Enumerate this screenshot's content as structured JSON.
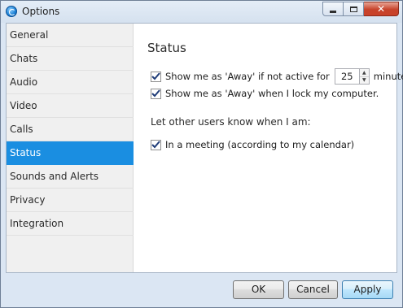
{
  "window": {
    "title": "Options",
    "buttons": {
      "minimize": "minimize",
      "maximize": "maximize",
      "close": "✕"
    }
  },
  "sidebar": {
    "items": [
      {
        "label": "General",
        "selected": false
      },
      {
        "label": "Chats",
        "selected": false
      },
      {
        "label": "Audio",
        "selected": false
      },
      {
        "label": "Video",
        "selected": false
      },
      {
        "label": "Calls",
        "selected": false
      },
      {
        "label": "Status",
        "selected": true
      },
      {
        "label": "Sounds and Alerts",
        "selected": false
      },
      {
        "label": "Privacy",
        "selected": false
      },
      {
        "label": "Integration",
        "selected": false
      }
    ]
  },
  "main": {
    "heading": "Status",
    "away_idle": {
      "checked": true,
      "label_before": "Show me as 'Away' if not active for",
      "minutes_value": "25",
      "label_after": "minutes."
    },
    "away_lock": {
      "checked": true,
      "label": "Show me as 'Away' when I lock my computer."
    },
    "notify_heading": "Let other users know when I am:",
    "in_meeting": {
      "checked": true,
      "label": "In a meeting (according to my calendar)"
    }
  },
  "footer": {
    "ok_label": "OK",
    "cancel_label": "Cancel",
    "apply_label": "Apply"
  },
  "colors": {
    "accent": "#1a8ee1",
    "checkmark": "#1f3c78",
    "frame": "#dbe6f3"
  }
}
